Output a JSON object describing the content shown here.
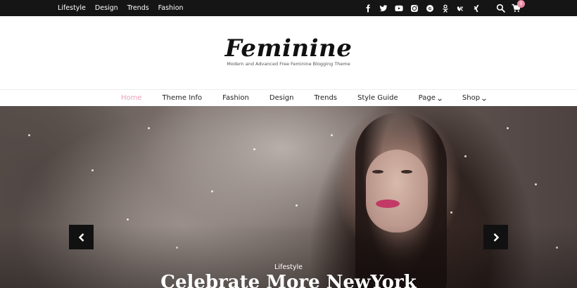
{
  "topbar": {
    "links": [
      "Lifestyle",
      "Design",
      "Trends",
      "Fashion"
    ],
    "social_icons": [
      "facebook-icon",
      "twitter-icon",
      "youtube-icon",
      "instagram-icon",
      "google-plus-icon",
      "odnoklassniki-icon",
      "vk-icon",
      "xing-icon"
    ],
    "cart_count": "0"
  },
  "header": {
    "logo": "Feminine",
    "tagline": "Modern and Advanced Free Feminine Blogging Theme"
  },
  "nav": {
    "items": [
      {
        "label": "Home",
        "active": true
      },
      {
        "label": "Theme Info"
      },
      {
        "label": "Fashion"
      },
      {
        "label": "Design"
      },
      {
        "label": "Trends"
      },
      {
        "label": "Style Guide"
      },
      {
        "label": "Page",
        "dropdown": true
      },
      {
        "label": "Shop",
        "dropdown": true
      }
    ]
  },
  "slider": {
    "category": "Lifestyle",
    "title": "Celebrate More NewYork"
  },
  "colors": {
    "topbar_bg": "#151515",
    "accent_pink": "#e9a2b6",
    "arrow_bg": "#111111"
  }
}
